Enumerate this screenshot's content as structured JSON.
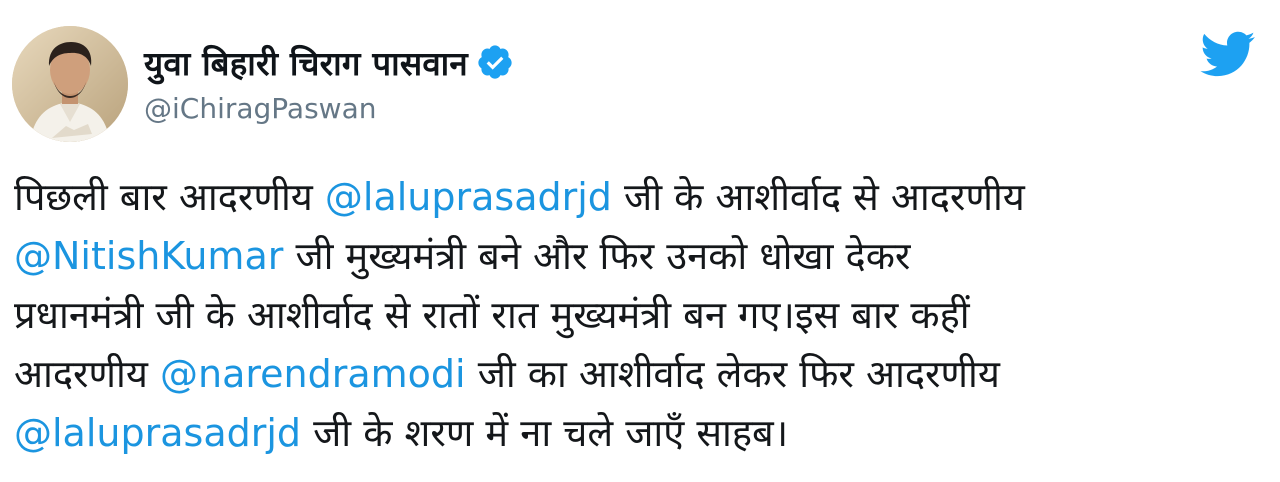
{
  "author": {
    "display_name": "युवा बिहारी चिराग पासवान",
    "handle": "@iChiragPaswan",
    "verified_icon": "verified-badge-icon",
    "avatar": "avatar"
  },
  "brand": {
    "icon": "twitter-bird-icon",
    "color": "#1da1f2"
  },
  "colors": {
    "mention": "#1b95e0",
    "text": "#14171a",
    "handle": "#657786"
  },
  "tweet": {
    "lines": [
      [
        {
          "text": "पिछली बार आदरणीय "
        },
        {
          "text": "@laluprasadrjd",
          "mention": true
        },
        {
          "text": " जी के आशीर्वाद से आदरणीय"
        }
      ],
      [
        {
          "text": "@NitishKumar",
          "mention": true
        },
        {
          "text": " जी मुख्यमंत्री बने और फिर उनको धोखा देकर"
        }
      ],
      [
        {
          "text": "प्रधानमंत्री जी के आशीर्वाद से रातों रात मुख्यमंत्री बन गए।इस बार कहीं"
        }
      ],
      [
        {
          "text": "आदरणीय "
        },
        {
          "text": "@narendramodi",
          "mention": true
        },
        {
          "text": " जी का आशीर्वाद लेकर फिर आदरणीय"
        }
      ],
      [
        {
          "text": "@laluprasadrjd",
          "mention": true
        },
        {
          "text": " जी के शरण में ना चले जाएँ साहब।"
        }
      ]
    ]
  }
}
